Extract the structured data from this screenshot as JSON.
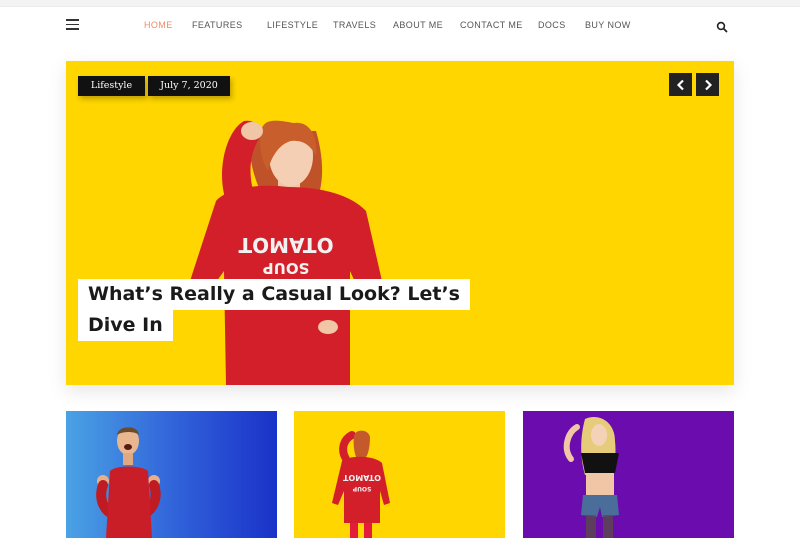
{
  "nav": {
    "items": [
      {
        "label": "HOME",
        "active": true
      },
      {
        "label": "FEATURES",
        "active": false
      },
      {
        "label": "LIFESTYLE",
        "active": false
      },
      {
        "label": "TRAVELS",
        "active": false
      },
      {
        "label": "ABOUT ME",
        "active": false
      },
      {
        "label": "CONTACT ME",
        "active": false
      },
      {
        "label": "DOCS",
        "active": false
      },
      {
        "label": "BUY NOW",
        "active": false
      }
    ],
    "menu_icon": "hamburger-icon",
    "search_icon": "search-icon"
  },
  "hero": {
    "category": "Lifestyle",
    "date": "July 7, 2020",
    "title": "What’s Really a Casual Look? Let’s Dive In",
    "sweatshirt_text_line1": "OTAMOT",
    "sweatshirt_text_line2": "SOUP",
    "prev_icon": "chevron-left-icon",
    "next_icon": "chevron-right-icon",
    "background": "#ffd600"
  },
  "cards": [
    {
      "background": "#2f5fd9"
    },
    {
      "background": "#ffd600",
      "sweatshirt_text_line1": "OTAMOT",
      "sweatshirt_text_line2": "SOUP"
    },
    {
      "background": "#6a0cae"
    }
  ],
  "colors": {
    "accent": "#ef8a6a",
    "nav_text": "#555555",
    "tag_bg": "#111111"
  }
}
